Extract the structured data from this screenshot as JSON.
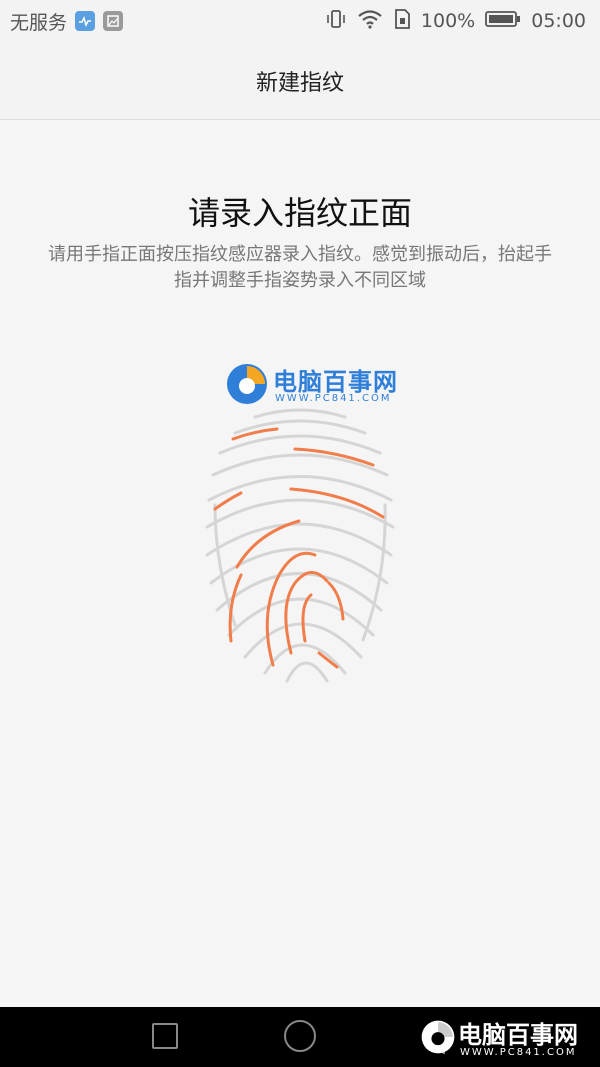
{
  "status_bar": {
    "carrier": "无服务",
    "battery_percent": "100%",
    "time": "05:00",
    "icons": [
      "health-app-icon",
      "gallery-app-icon",
      "vibrate-icon",
      "wifi-icon",
      "sim-icon",
      "battery-icon"
    ]
  },
  "app_bar": {
    "title": "新建指纹"
  },
  "main": {
    "heading": "请录入指纹正面",
    "description": "请用手指正面按压指纹感应器录入指纹。感觉到振动后，抬起手指并调整手指姿势录入不同区域",
    "fingerprint_progress_color": "#f07d4a",
    "fingerprint_base_color": "#d5d5d5"
  },
  "watermark": {
    "name": "电脑百事网",
    "url": "WWW.PC841.COM"
  },
  "nav_bar": {
    "buttons": [
      "recent-apps-button",
      "home-button",
      "back-button"
    ]
  }
}
